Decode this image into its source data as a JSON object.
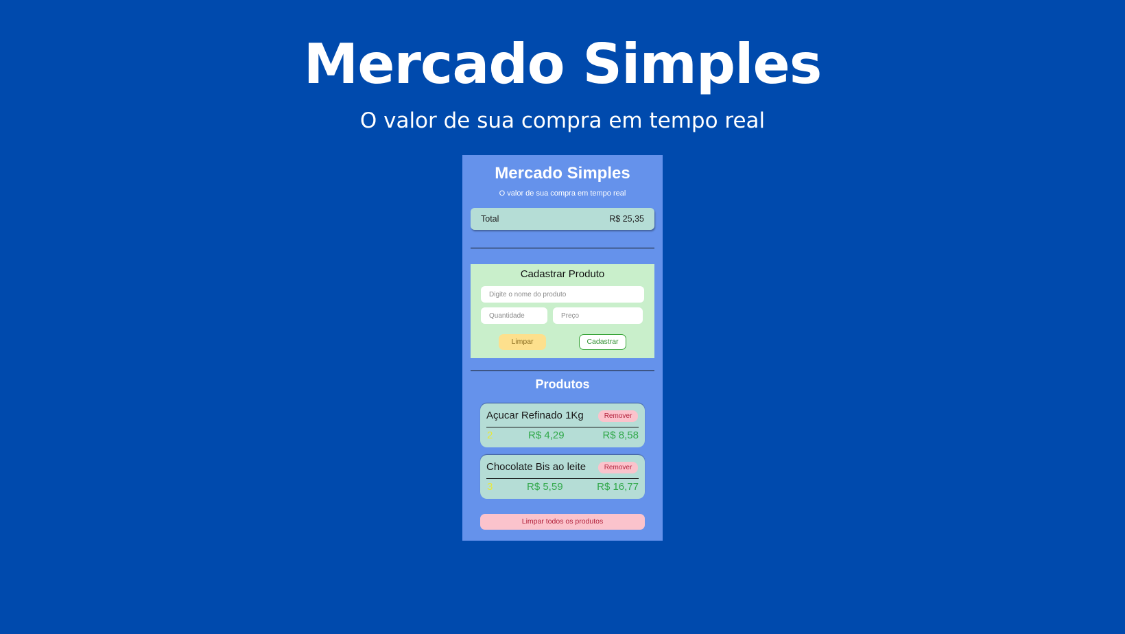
{
  "hero": {
    "title": "Mercado Simples",
    "subtitle": "O valor de sua compra em tempo real"
  },
  "app": {
    "title": "Mercado Simples",
    "subtitle": "O valor de sua compra em tempo real",
    "total": {
      "label": "Total",
      "value": "R$ 25,35"
    },
    "form": {
      "title": "Cadastrar Produto",
      "name_placeholder": "Digite o nome do produto",
      "qty_placeholder": "Quantidade",
      "price_placeholder": "Preço",
      "clear_label": "Limpar",
      "register_label": "Cadastrar"
    },
    "products_title": "Produtos",
    "products": [
      {
        "name": "Açucar Refinado 1Kg",
        "remove_label": "Remover",
        "qty": "2",
        "unit_price": "R$ 4,29",
        "total": "R$ 8,58"
      },
      {
        "name": "Chocolate Bis ao leite",
        "remove_label": "Remover",
        "qty": "3",
        "unit_price": "R$ 5,59",
        "total": "R$ 16,77"
      }
    ],
    "clear_all_label": "Limpar todos os produtos"
  },
  "colors": {
    "page_background": "#004aad",
    "phone_background": "#6592eb",
    "total_card": "#b5ddd6",
    "form_card": "#c9efcb",
    "clear_button": "#fde08d",
    "remove_button": "#fbc3cc",
    "price_green": "#31a84a",
    "qty_yellow": "#e8e83a"
  }
}
